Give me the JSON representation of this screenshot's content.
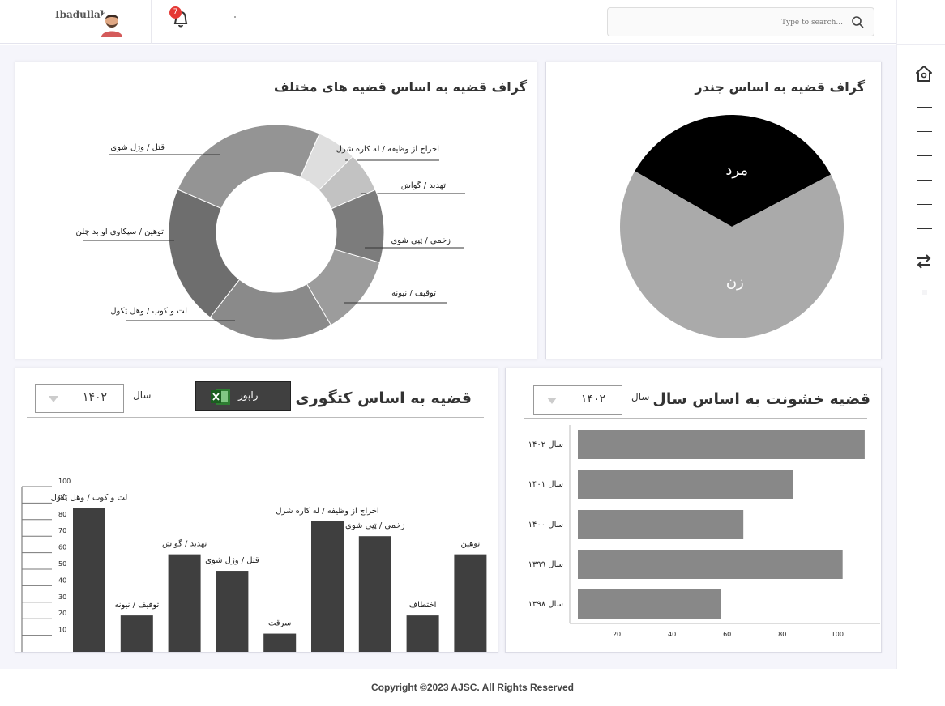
{
  "header": {
    "user_name": "Ibadullah",
    "notification_count": "7",
    "search_placeholder": "Type to search..."
  },
  "cards": {
    "types_title": "گراف قضیه به اساس قضیه های مختلف",
    "gender_title": "گراف قضیه به اساس جندر",
    "category_title": "قضیه به اساس کتگوری",
    "violence_title": "قضیه خشونت به اساس سال",
    "year_label": "سال",
    "selected_year": "۱۴۰۲",
    "export_label": "راپور"
  },
  "colors": {
    "bar_dark": "#3f3f3f",
    "bar_mid": "#888888",
    "badge_red": "#e53935"
  },
  "chart_data": [
    {
      "type": "pie",
      "donut": true,
      "labels": [
        "اخراج از وظیفه / له کاره شرل",
        "تهدید / گواښ",
        "زخمی / ټپی شوی",
        "توقیف / نیونه",
        "لت و کوب / وهل ټکول",
        "توهین / سپکاوی او بد چلن",
        "قتل / وژل شوی"
      ],
      "values": [
        6,
        6,
        11,
        12,
        19,
        21,
        25
      ],
      "colors": [
        "#dedede",
        "#c2c2c2",
        "#7c7c7c",
        "#9c9c9c",
        "#8a8a8a",
        "#6e6e6e",
        "#949494"
      ]
    },
    {
      "type": "pie",
      "labels": [
        "مرد",
        "زن"
      ],
      "values": [
        34,
        66
      ],
      "colors": [
        "#000000",
        "#aaaaaa"
      ]
    },
    {
      "type": "bar",
      "categories": [
        "لت و کوب / وهل ټکول",
        "توقیف / نیونه",
        "تهدید / گواښ",
        "قتل / وژل شوی",
        "سرقت",
        "اخراج از وظیفه / له کاره شرل",
        "زخمی / ټپی شوی",
        "اختطاف",
        "توهین"
      ],
      "values": [
        87,
        22,
        59,
        49,
        11,
        79,
        70,
        22,
        59
      ],
      "ylim": [
        0,
        100
      ],
      "yticks": [
        10,
        20,
        30,
        40,
        50,
        60,
        70,
        80,
        90,
        100
      ]
    },
    {
      "type": "bar",
      "orientation": "horizontal",
      "categories": [
        "سال ۱۴۰۲",
        "سال ۱۴۰۱",
        "سال ۱۴۰۰",
        "سال ۱۳۹۹",
        "سال ۱۳۹۸"
      ],
      "values": [
        104,
        78,
        60,
        96,
        52
      ],
      "xticks": [
        20,
        40,
        60,
        80,
        100
      ]
    }
  ],
  "footer": {
    "copyright": "Copyright ©2023 AJSC. All Rights Reserved"
  }
}
